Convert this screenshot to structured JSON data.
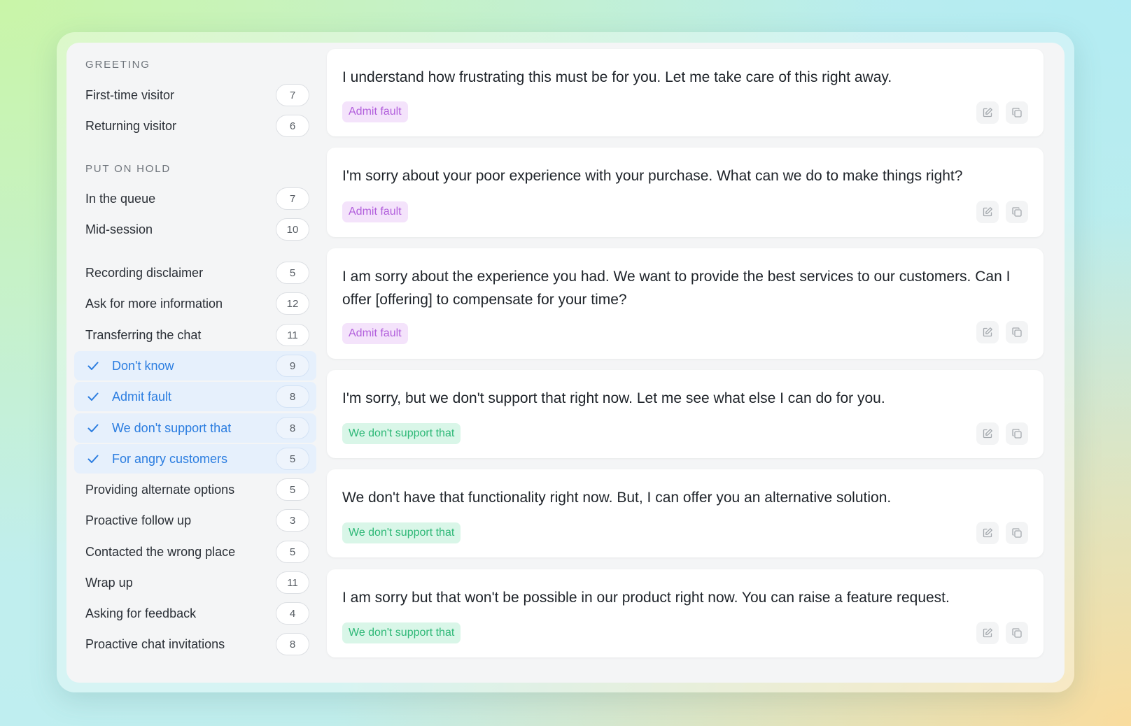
{
  "sidebar": {
    "greeting_title": "GREETING",
    "hold_title": "PUT ON HOLD",
    "items": [
      {
        "label": "First-time visitor",
        "count": "7"
      },
      {
        "label": "Returning visitor",
        "count": "6"
      },
      {
        "label": "In the queue",
        "count": "7"
      },
      {
        "label": "Mid-session",
        "count": "10"
      },
      {
        "label": "Recording disclaimer",
        "count": "5"
      },
      {
        "label": "Ask for more information",
        "count": "12"
      },
      {
        "label": "Transferring the chat",
        "count": "11"
      },
      {
        "label": "Don't know",
        "count": "9",
        "selected": true
      },
      {
        "label": "Admit fault",
        "count": "8",
        "selected": true
      },
      {
        "label": "We don't support that",
        "count": "8",
        "selected": true
      },
      {
        "label": "For angry customers",
        "count": "5",
        "selected": true
      },
      {
        "label": "Providing alternate options",
        "count": "5"
      },
      {
        "label": "Proactive follow up",
        "count": "3"
      },
      {
        "label": "Contacted the wrong place",
        "count": "5"
      },
      {
        "label": "Wrap up",
        "count": "11"
      },
      {
        "label": "Asking for feedback",
        "count": "4"
      },
      {
        "label": "Proactive chat invitations",
        "count": "8"
      }
    ]
  },
  "cards": [
    {
      "text": "I understand how frustrating this must be for you. Let me take care of this right away.",
      "tag": "Admit fault"
    },
    {
      "text": "I'm sorry about your poor experience with your purchase. What can we do to make things right?",
      "tag": "Admit fault"
    },
    {
      "text": "I am sorry about the experience you had. We want to provide the best services to our customers. Can I offer [offering] to compensate for your time?",
      "tag": "Admit fault"
    },
    {
      "text": "I'm sorry, but we don't support that right now. Let me see what else I can do for you.",
      "tag": "We don't support that"
    },
    {
      "text": "We don't have that functionality right now. But, I can offer you an alternative solution.",
      "tag": "We don't support that"
    },
    {
      "text": "I am sorry but that won't be possible in our product right now. You can raise a feature request.",
      "tag": "We don't support that"
    }
  ],
  "colors": {
    "accent_blue": "#2b7de0",
    "tag_purple": "#b25fdc",
    "tag_green": "#2eb877"
  },
  "icons": {
    "check": "check-icon",
    "edit": "edit-icon",
    "copy": "copy-icon"
  }
}
